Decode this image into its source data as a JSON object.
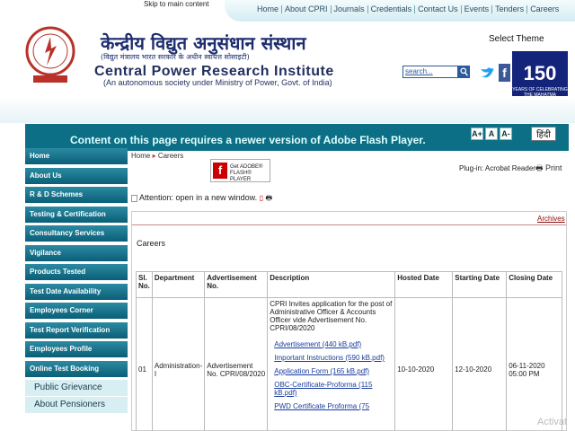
{
  "skip_link": "Skip to main content",
  "topnav": [
    "Home",
    "About CPRI",
    "Journals",
    "Credentials",
    "Contact Us",
    "Events",
    "Tenders",
    "Careers"
  ],
  "header": {
    "hindi_title": "केन्द्रीय विद्युत अनुसंधान संस्थान",
    "hindi_sub": "(विद्युत मंत्रालय भारत सरकार के अधीन स्वायत्त सोसाइटी)",
    "title": "Central Power Research Institute",
    "subtitle": "(An autonomous society under Ministry of Power, Govt. of India)",
    "select_theme": "Select Theme",
    "search_placeholder": "search...",
    "badge_number": "150",
    "badge_text": "YEARS OF CELEBRATING THE MAHATMA"
  },
  "flash_message": "Content on this page requires a newer version of Adobe Flash Player.",
  "font_controls": [
    "A+",
    "A",
    "A-"
  ],
  "hindi_button": "हिंदी",
  "sidebar": {
    "items": [
      "Home",
      "About Us",
      "R & D Schemes",
      "Testing & Certification",
      "Consultancy Services",
      "Vigilance",
      "Products Tested",
      "Test Date Availability",
      "Employees Corner",
      "Test Report Verification",
      "Employees Profile",
      "Online Test Booking"
    ],
    "light_items": [
      "Public Grievance",
      "About Pensioners"
    ]
  },
  "breadcrumb": [
    "Home",
    "Careers"
  ],
  "flash_button_text": "Get ADOBE® FLASH® PLAYER",
  "plugin_text": "Plug-in: Acrobat Reader",
  "print_text": "Print",
  "attention_text": "Attention: open in a new window.",
  "archives_link": "Archives",
  "careers_heading": "Careers",
  "table": {
    "headers": [
      "Sl. No.",
      "Department",
      "Advertisement No.",
      "Description",
      "Hosted Date",
      "Starting Date",
      "Closing Date"
    ],
    "rows": [
      {
        "sl": "01",
        "department": "Administration-I",
        "adv_no": "Advertisement No. CPRI/08/2020",
        "description": "CPRI Invites application for the post of Administrative Officer & Accounts Officer vide Advertisement No. CPRI/08/2020",
        "links": [
          "Advertisement (440 kB.pdf)",
          "Important Instructions (590 kB.pdf)",
          "Application Form (165 kB.pdf)",
          "OBC-Certificate-Proforma (115 kB.pdf)",
          "PWD Certificate Proforma (75"
        ],
        "hosted": "10-10-2020",
        "starting": "12-10-2020",
        "closing": "06-11-2020 05:00 PM"
      }
    ]
  },
  "watermark": "Activat"
}
